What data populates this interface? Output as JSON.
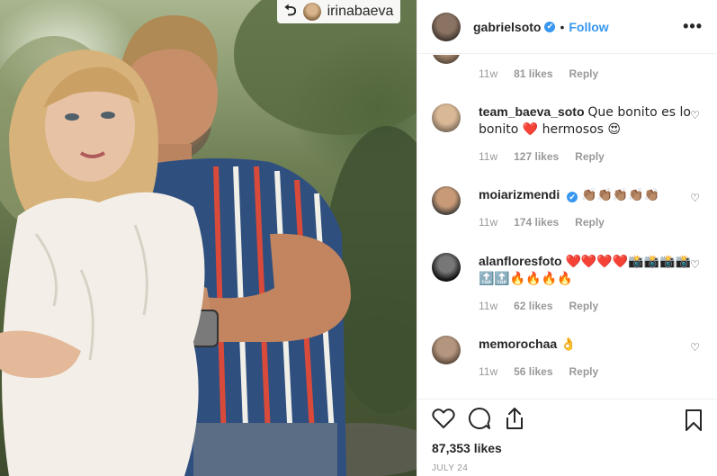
{
  "photo": {
    "repost_user": "irinabaeva",
    "repost_icon": "repost-icon"
  },
  "header": {
    "username": "gabrielsoto",
    "verified": "✔",
    "separator": "•",
    "follow_label": "Follow",
    "more_icon": "•••"
  },
  "comments": [
    {
      "user": "",
      "text": "",
      "time": "11w",
      "likes": "81 likes",
      "reply": "Reply"
    },
    {
      "user": "team_baeva_soto",
      "text": "Que bonito es lo bonito ❤️ hermosos 😍",
      "time": "11w",
      "likes": "127 likes",
      "reply": "Reply"
    },
    {
      "user": "moiarizmendi",
      "verified": "✔",
      "text": "👏🏽👏🏽👏🏽👏🏽👏🏽",
      "time": "11w",
      "likes": "174 likes",
      "reply": "Reply"
    },
    {
      "user": "alanfloresfoto",
      "text": "❤️❤️❤️❤️📸📸📸📸🔝🔝🔥🔥🔥🔥",
      "time": "11w",
      "likes": "62 likes",
      "reply": "Reply"
    },
    {
      "user": "memorochaa",
      "text": "👌",
      "time": "11w",
      "likes": "56 likes",
      "reply": "Reply"
    }
  ],
  "footer": {
    "likes": "87,353 likes",
    "date": "JULY 24"
  },
  "colors": {
    "accent": "#3897f0",
    "text": "#262626",
    "muted": "#999999"
  }
}
